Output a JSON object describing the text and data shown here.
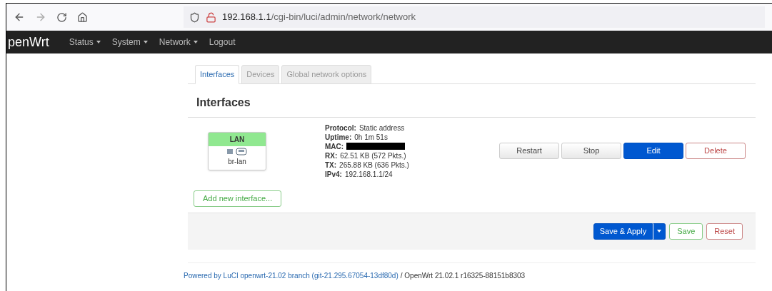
{
  "browser": {
    "url_host": "192.168.1.1",
    "url_path": "/cgi-bin/luci/admin/network/network"
  },
  "navbar": {
    "brand": "penWrt",
    "menus": [
      {
        "label": "Status",
        "dropdown": true
      },
      {
        "label": "System",
        "dropdown": true
      },
      {
        "label": "Network",
        "dropdown": true
      },
      {
        "label": "Logout",
        "dropdown": false
      }
    ]
  },
  "tabs": [
    {
      "label": "Interfaces",
      "selected": true
    },
    {
      "label": "Devices",
      "selected": false
    },
    {
      "label": "Global network options",
      "selected": false
    }
  ],
  "heading": "Interfaces",
  "interfaces": [
    {
      "name": "LAN",
      "device": "br-lan",
      "color": "#90e890",
      "details": [
        {
          "label": "Protocol:",
          "value": "Static address"
        },
        {
          "label": "Uptime:",
          "value": "0h 1m 51s"
        },
        {
          "label": "MAC:",
          "redacted": true
        },
        {
          "label": "RX:",
          "value": "62.51 KB (572 Pkts.)"
        },
        {
          "label": "TX:",
          "value": "265.88 KB (636 Pkts.)"
        },
        {
          "label": "IPv4:",
          "value": "192.168.1.1/24"
        }
      ],
      "actions": [
        {
          "label": "Restart",
          "kind": "neutral"
        },
        {
          "label": "Stop",
          "kind": "neutral"
        },
        {
          "label": "Edit",
          "kind": "primary"
        },
        {
          "label": "Delete",
          "kind": "negative"
        }
      ]
    }
  ],
  "add_button": "Add new interface...",
  "footer_actions": [
    {
      "label": "Save & Apply",
      "kind": "apply"
    },
    {
      "label": "Save",
      "kind": "positive"
    },
    {
      "label": "Reset",
      "kind": "negative"
    }
  ],
  "footer": {
    "link": "Powered by LuCI openwrt-21.02 branch (git-21.295.67054-13df80d)",
    "version": "/ OpenWrt 21.02.1 r16325-88151b8303"
  }
}
